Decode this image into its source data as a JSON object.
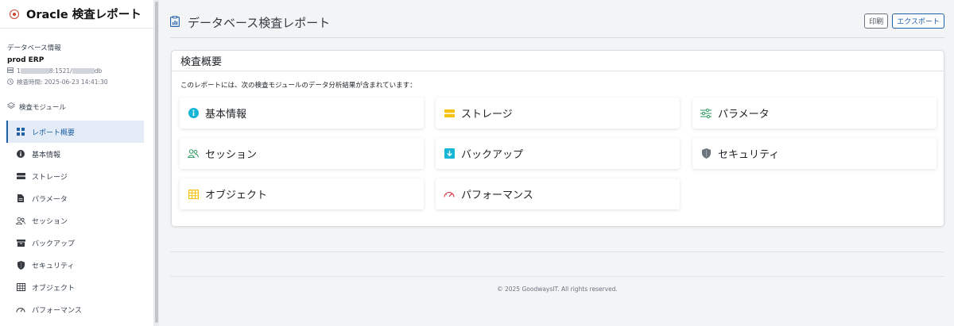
{
  "app": {
    "title": "Oracle 検査レポート"
  },
  "sidebar": {
    "db_info": {
      "heading": "データベース情報",
      "name": "prod ERP",
      "host_prefix": "1",
      "host_middle": "8:1521/",
      "host_suffix": "db",
      "time_label": "検査時間: 2025-06-23 14:41:30"
    },
    "modules_heading": "検査モジュール",
    "items": [
      {
        "label": "レポート概要",
        "icon": "grid-icon",
        "active": true
      },
      {
        "label": "基本情報",
        "icon": "info-icon"
      },
      {
        "label": "ストレージ",
        "icon": "storage-icon"
      },
      {
        "label": "パラメータ",
        "icon": "file-icon"
      },
      {
        "label": "セッション",
        "icon": "people-icon"
      },
      {
        "label": "バックアップ",
        "icon": "archive-icon"
      },
      {
        "label": "セキュリティ",
        "icon": "shield-icon"
      },
      {
        "label": "オブジェクト",
        "icon": "table-icon"
      },
      {
        "label": "パフォーマンス",
        "icon": "speedometer-icon"
      }
    ]
  },
  "header": {
    "title": "データベース検査レポート",
    "print_label": "印刷",
    "export_label": "エクスポート"
  },
  "overview": {
    "title": "検査概要",
    "description": "このレポートには、次の検査モジュールのデータ分析結果が含まれています：",
    "modules": [
      {
        "label": "基本情報",
        "icon": "info-icon",
        "color": "#17b6d6"
      },
      {
        "label": "ストレージ",
        "icon": "storage-icon",
        "color": "#f5c211"
      },
      {
        "label": "パラメータ",
        "icon": "sliders-icon",
        "color": "#2e9b5f"
      },
      {
        "label": "セッション",
        "icon": "people-icon",
        "color": "#2e9b5f"
      },
      {
        "label": "バックアップ",
        "icon": "download-icon",
        "color": "#17b6d6"
      },
      {
        "label": "セキュリティ",
        "icon": "shield-icon",
        "color": "#6c757d"
      },
      {
        "label": "オブジェクト",
        "icon": "table-icon",
        "color": "#f5c211"
      },
      {
        "label": "パフォーマンス",
        "icon": "speedometer-icon",
        "color": "#dc3545"
      }
    ]
  },
  "footer": {
    "text": "© 2025 GoodwaysIT. All rights reserved."
  },
  "colors": {
    "accent": "#1f5fa6",
    "active_bg": "#e3ecf7"
  }
}
